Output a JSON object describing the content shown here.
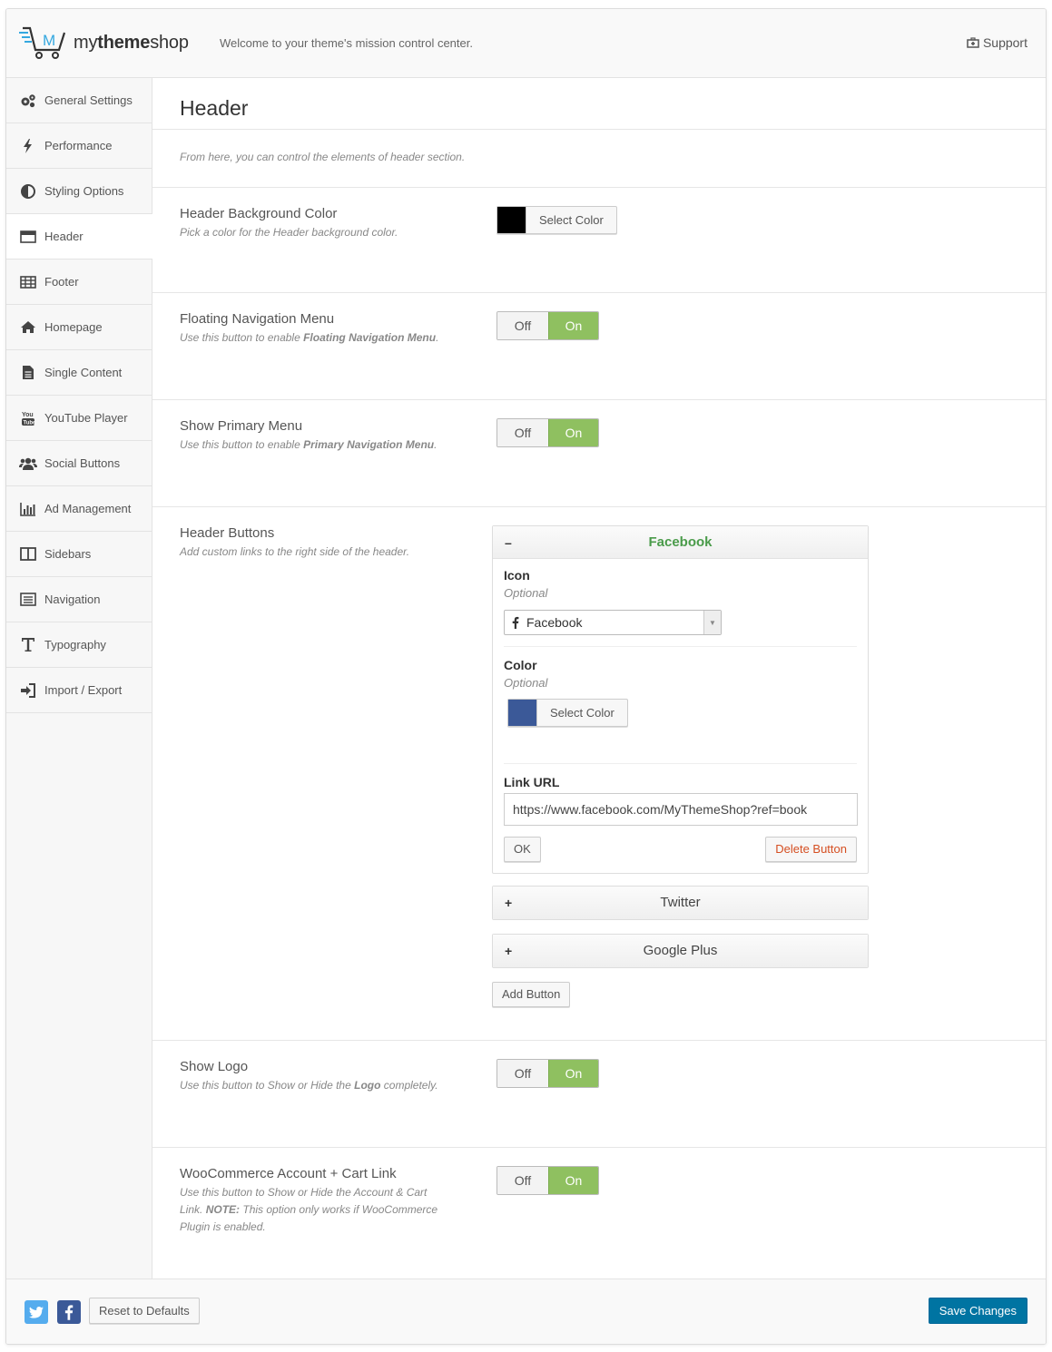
{
  "topbar": {
    "logo_light": "my",
    "logo_bold": "theme",
    "logo_end": "shop",
    "tagline": "Welcome to your theme's mission control center.",
    "support_label": "Support"
  },
  "sidebar": {
    "items": [
      {
        "label": "General Settings",
        "icon": "gears-icon"
      },
      {
        "label": "Performance",
        "icon": "bolt-icon"
      },
      {
        "label": "Styling Options",
        "icon": "contrast-icon"
      },
      {
        "label": "Header",
        "icon": "header-icon"
      },
      {
        "label": "Footer",
        "icon": "table-icon"
      },
      {
        "label": "Homepage",
        "icon": "home-icon"
      },
      {
        "label": "Single Content",
        "icon": "document-icon"
      },
      {
        "label": "YouTube Player",
        "icon": "youtube-icon"
      },
      {
        "label": "Social Buttons",
        "icon": "users-icon"
      },
      {
        "label": "Ad Management",
        "icon": "bar-chart-icon"
      },
      {
        "label": "Sidebars",
        "icon": "columns-icon"
      },
      {
        "label": "Navigation",
        "icon": "list-icon"
      },
      {
        "label": "Typography",
        "icon": "text-icon"
      },
      {
        "label": "Import / Export",
        "icon": "sign-in-icon"
      }
    ],
    "active_index": 3
  },
  "main": {
    "title": "Header",
    "description": "From here, you can control the elements of header section.",
    "bg_color": {
      "title": "Header Background Color",
      "desc": "Pick a color for the Header background color.",
      "button": "Select Color",
      "swatch": "#000000"
    },
    "floating_nav": {
      "title": "Floating Navigation Menu",
      "desc_pre": "Use this button to enable ",
      "desc_bold": "Floating Navigation Menu",
      "desc_post": ".",
      "off": "Off",
      "on": "On"
    },
    "primary_menu": {
      "title": "Show Primary Menu",
      "desc_pre": "Use this button to enable ",
      "desc_bold": "Primary Navigation Menu",
      "desc_post": ".",
      "off": "Off",
      "on": "On"
    },
    "header_buttons": {
      "title": "Header Buttons",
      "desc": "Add custom links to the right side of the header.",
      "open_item": {
        "toggle": "–",
        "name": "Facebook",
        "icon_label": "Icon",
        "icon_optional": "Optional",
        "icon_value": "Facebook",
        "color_label": "Color",
        "color_optional": "Optional",
        "color_button": "Select Color",
        "color_swatch": "#3b5998",
        "url_label": "Link URL",
        "url_value": "https://www.facebook.com/MyThemeShop?ref=book",
        "ok": "OK",
        "delete": "Delete Button"
      },
      "closed_items": [
        {
          "toggle": "+",
          "name": "Twitter"
        },
        {
          "toggle": "+",
          "name": "Google Plus"
        }
      ],
      "add_button": "Add Button"
    },
    "show_logo": {
      "title": "Show Logo",
      "desc_pre": "Use this button to Show or Hide the ",
      "desc_bold": "Logo",
      "desc_post": " completely.",
      "off": "Off",
      "on": "On"
    },
    "woocommerce": {
      "title": "WooCommerce Account + Cart Link",
      "desc_pre": "Use this button to Show or Hide the Account & Cart Link. ",
      "desc_bold": "NOTE:",
      "desc_post": " This option only works if WooCommerce Plugin is enabled.",
      "off": "Off",
      "on": "On"
    }
  },
  "footer": {
    "reset": "Reset to Defaults",
    "save": "Save Changes"
  },
  "colors": {
    "accent_green": "#8fc060",
    "primary_blue": "#0074a2",
    "twitter": "#55acee",
    "facebook": "#3b5998"
  }
}
